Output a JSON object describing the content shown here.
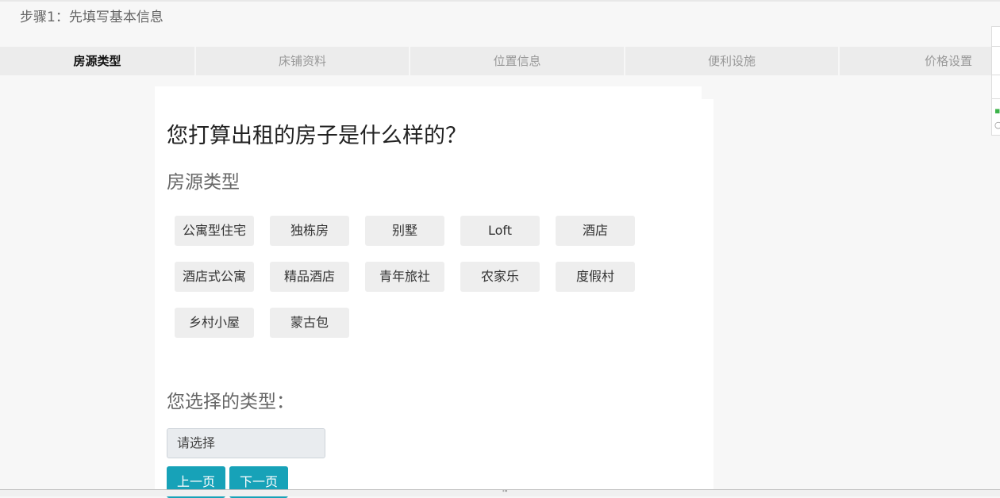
{
  "header": {
    "step_title": "步骤1：先填写基本信息"
  },
  "tabs": [
    {
      "label": "房源类型",
      "active": true
    },
    {
      "label": "床铺资料",
      "active": false
    },
    {
      "label": "位置信息",
      "active": false
    },
    {
      "label": "便利设施",
      "active": false
    },
    {
      "label": "价格设置",
      "active": false
    }
  ],
  "main": {
    "question": "您打算出租的房子是什么样的？",
    "section_title": "房源类型",
    "types": [
      "公寓型住宅",
      "独栋房",
      "别墅",
      "Loft",
      "酒店",
      "酒店式公寓",
      "精品酒店",
      "青年旅社",
      "农家乐",
      "度假村",
      "乡村小屋",
      "蒙古包"
    ],
    "chosen_title": "您选择的类型：",
    "select_placeholder": "请选择",
    "prev_label": "上一页",
    "next_label": "下一页"
  },
  "colors": {
    "accent": "#17a2b8",
    "chip_bg": "#eeeeee",
    "page_bg": "#f7f7f7"
  }
}
